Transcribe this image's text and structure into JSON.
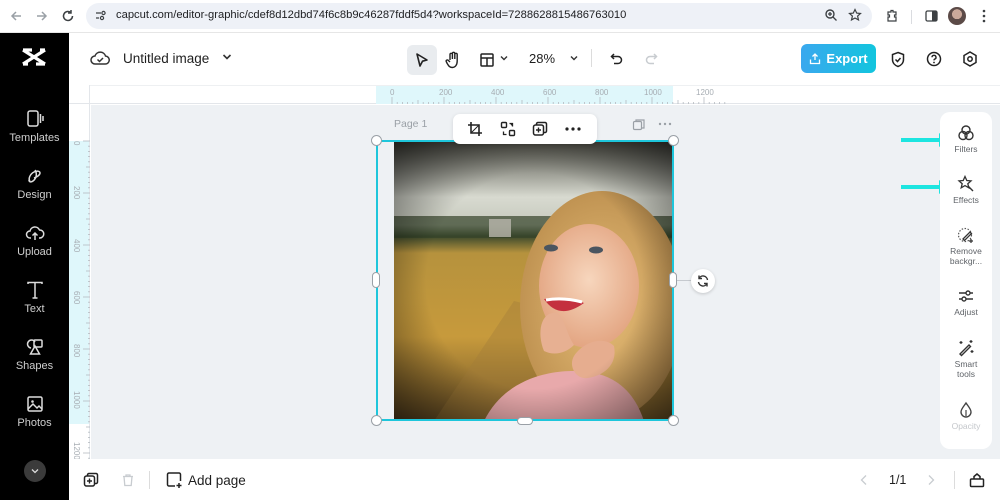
{
  "browser": {
    "url": "capcut.com/editor-graphic/cdef8d12dbd74f6c8b9c46287fddf5d4?workspaceId=7288628815486763010",
    "icons": [
      "back-icon",
      "forward-icon",
      "reload-icon",
      "site-settings-icon",
      "zoom-icon",
      "bookmark-star-icon",
      "extensions-icon",
      "side-panel-icon",
      "profile-avatar",
      "menu-kebab-icon"
    ]
  },
  "sidebar": {
    "logo": "capcut-logo",
    "items": [
      {
        "label": "Templates",
        "icon": "templates-icon"
      },
      {
        "label": "Design",
        "icon": "design-icon"
      },
      {
        "label": "Upload",
        "icon": "upload-icon"
      },
      {
        "label": "Text",
        "icon": "text-icon"
      },
      {
        "label": "Shapes",
        "icon": "shapes-icon"
      },
      {
        "label": "Photos",
        "icon": "photos-icon"
      }
    ]
  },
  "topbar": {
    "title": "Untitled image",
    "zoom": "28%",
    "export_label": "Export",
    "accent": "#1ec6db"
  },
  "rulers": {
    "top": [
      "0",
      "200",
      "400",
      "600",
      "800",
      "1000",
      "1200"
    ],
    "left": [
      "0",
      "200",
      "400",
      "600",
      "800",
      "1000",
      "1200"
    ]
  },
  "canvas": {
    "page_label": "Page 1",
    "float_toolbar": [
      "crop-icon",
      "replace-icon",
      "duplicate-icon",
      "more-icon"
    ]
  },
  "right_panel": {
    "items": [
      {
        "label": "Filters",
        "icon": "filters-icon"
      },
      {
        "label": "Effects",
        "icon": "effects-icon"
      },
      {
        "label": "Remove backgr...",
        "icon": "remove-background-icon"
      },
      {
        "label": "Adjust",
        "icon": "adjust-icon"
      },
      {
        "label": "Smart tools",
        "icon": "smart-tools-icon"
      },
      {
        "label": "Opacity",
        "icon": "opacity-icon"
      }
    ]
  },
  "bottombar": {
    "add_page_label": "Add page",
    "page_count": "1/1"
  }
}
